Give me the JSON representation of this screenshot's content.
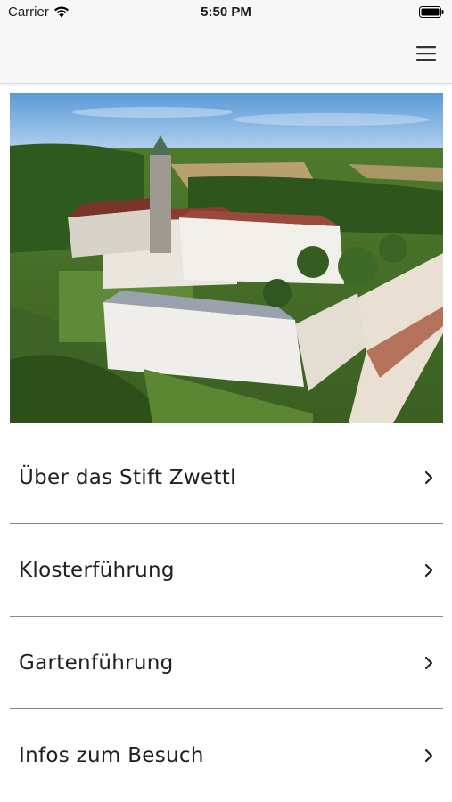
{
  "status_bar": {
    "carrier": "Carrier",
    "time": "5:50 PM",
    "icons": [
      "wifi-icon",
      "battery-icon"
    ]
  },
  "nav_bar": {
    "menu_icon": "hamburger-menu-icon"
  },
  "hero": {
    "description_icon": "abbey-aerial-photo"
  },
  "menu": {
    "items": [
      {
        "label": "Über das Stift Zwettl",
        "icon": "chevron-right-icon"
      },
      {
        "label": "Klosterführung",
        "icon": "chevron-right-icon"
      },
      {
        "label": "Gartenführung",
        "icon": "chevron-right-icon"
      },
      {
        "label": "Infos zum Besuch",
        "icon": "chevron-right-icon"
      }
    ]
  },
  "colors": {
    "bar_background": "#f7f7f7",
    "divider": "#8a8a8a",
    "text": "#1f1f1f"
  }
}
